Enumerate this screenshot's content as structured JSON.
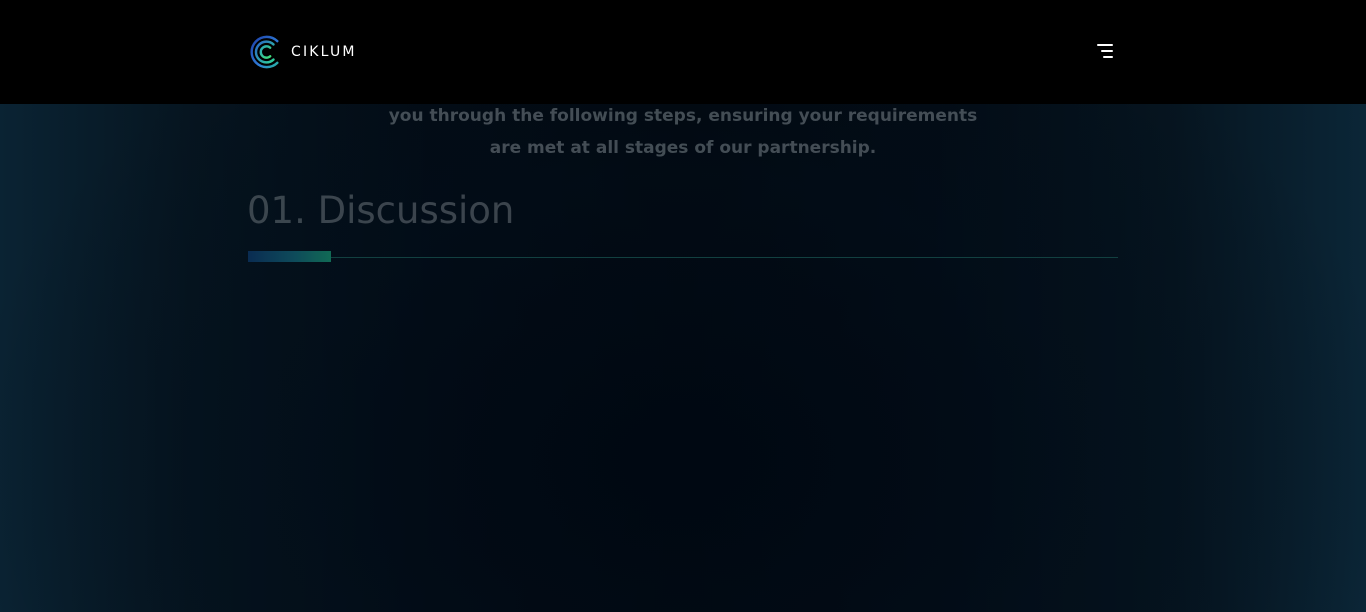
{
  "header": {
    "brand_name": "CIKLUM",
    "logo_icon": "ciklum-logo-icon",
    "menu_icon": "hamburger-menu-icon",
    "colors": {
      "background": "#000000",
      "logo_arc_outer": "#2f7bd6",
      "logo_arc_mid": "#27b3a3",
      "logo_arc_inner": "#36d47f"
    }
  },
  "process": {
    "intro_line_1": "you through the following steps, ensuring your requirements",
    "intro_line_2": "are met at all stages of our partnership.",
    "current_step_title": "01. Discussion",
    "progress": 0.095,
    "colors": {
      "track": "#124040",
      "fill_start": "#0a2c52",
      "fill_end": "#116a55"
    }
  }
}
